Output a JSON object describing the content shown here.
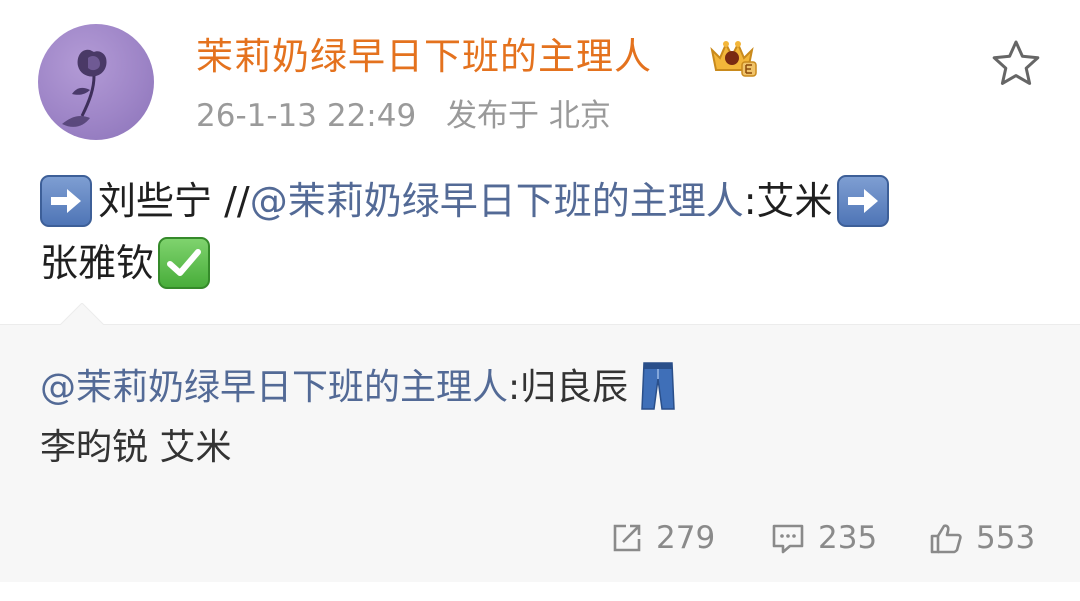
{
  "user": {
    "name": "茉莉奶绿早日下班的主理人",
    "avatar_icon": "rose-avatar-icon",
    "badge_icon": "vip-crown-badge-icon"
  },
  "post": {
    "timestamp": "26-1-13 22:49",
    "location_prefix": "发布于",
    "location": "北京",
    "line1_text": "刘些宁 //",
    "line1_mention": "@茉莉奶绿早日下班的主理人",
    "line1_after": ":艾米",
    "line2_text": "张雅钦"
  },
  "repost": {
    "mention": "@茉莉奶绿早日下班的主理人",
    "line1_after": ":归良辰",
    "line2_text": "李昀锐 艾米"
  },
  "actions": {
    "repost_count": "279",
    "comment_count": "235",
    "like_count": "553"
  },
  "colors": {
    "username": "#e4721e",
    "mention": "#536a96",
    "meta": "#9a9a9a",
    "repost_bg": "#f7f7f7"
  }
}
